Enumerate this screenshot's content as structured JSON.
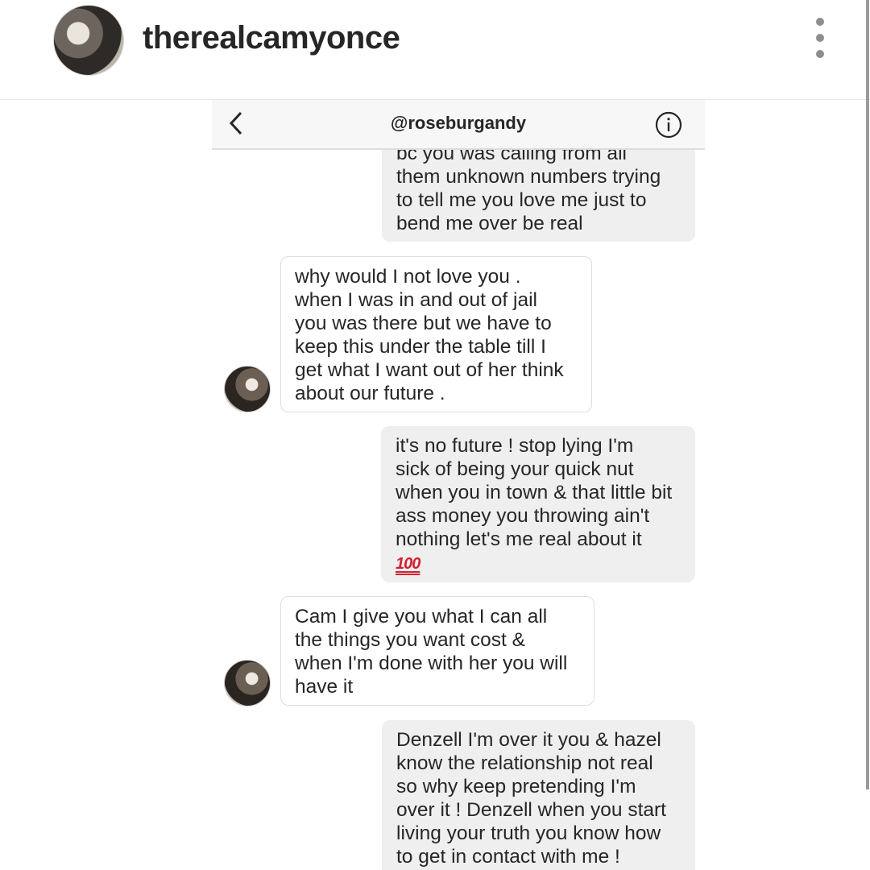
{
  "post": {
    "username": "therealcamyonce"
  },
  "dm": {
    "title": "@roseburgandy",
    "messages": [
      {
        "from": "me",
        "lines": [
          "bc you was calling from all",
          "them unknown numbers trying",
          "to tell me you love me just to",
          "bend me over be real"
        ]
      },
      {
        "from": "them",
        "lines": [
          "why would I not love you .",
          "when I was in and out of jail",
          "you was there but we have to",
          "keep this under the table till I",
          "get what I want out of her think",
          "about our future ."
        ]
      },
      {
        "from": "me",
        "lines": [
          "it's no future ! stop lying I'm",
          "sick of being your quick nut",
          "when you in town & that little bit",
          "ass money you throwing ain't",
          "nothing let's me real about it"
        ],
        "emoji": "100"
      },
      {
        "from": "them",
        "lines": [
          "Cam I give you what I can all",
          "the things you want cost &",
          "when I'm done with her you will",
          "have it"
        ]
      },
      {
        "from": "me",
        "lines": [
          "Denzell I'm over it you & hazel",
          "know the relationship not real",
          "so why keep pretending I'm",
          "over it ! Denzell when you start",
          "living your truth you know how",
          "to get in contact with me !"
        ]
      }
    ]
  },
  "icons": {
    "more": "more-vertical-icon",
    "back": "chevron-left-icon",
    "info": "info-icon"
  },
  "colors": {
    "sent_bubble": "#efefef",
    "received_border": "#dedede",
    "emoji_red": "#d2202f"
  }
}
